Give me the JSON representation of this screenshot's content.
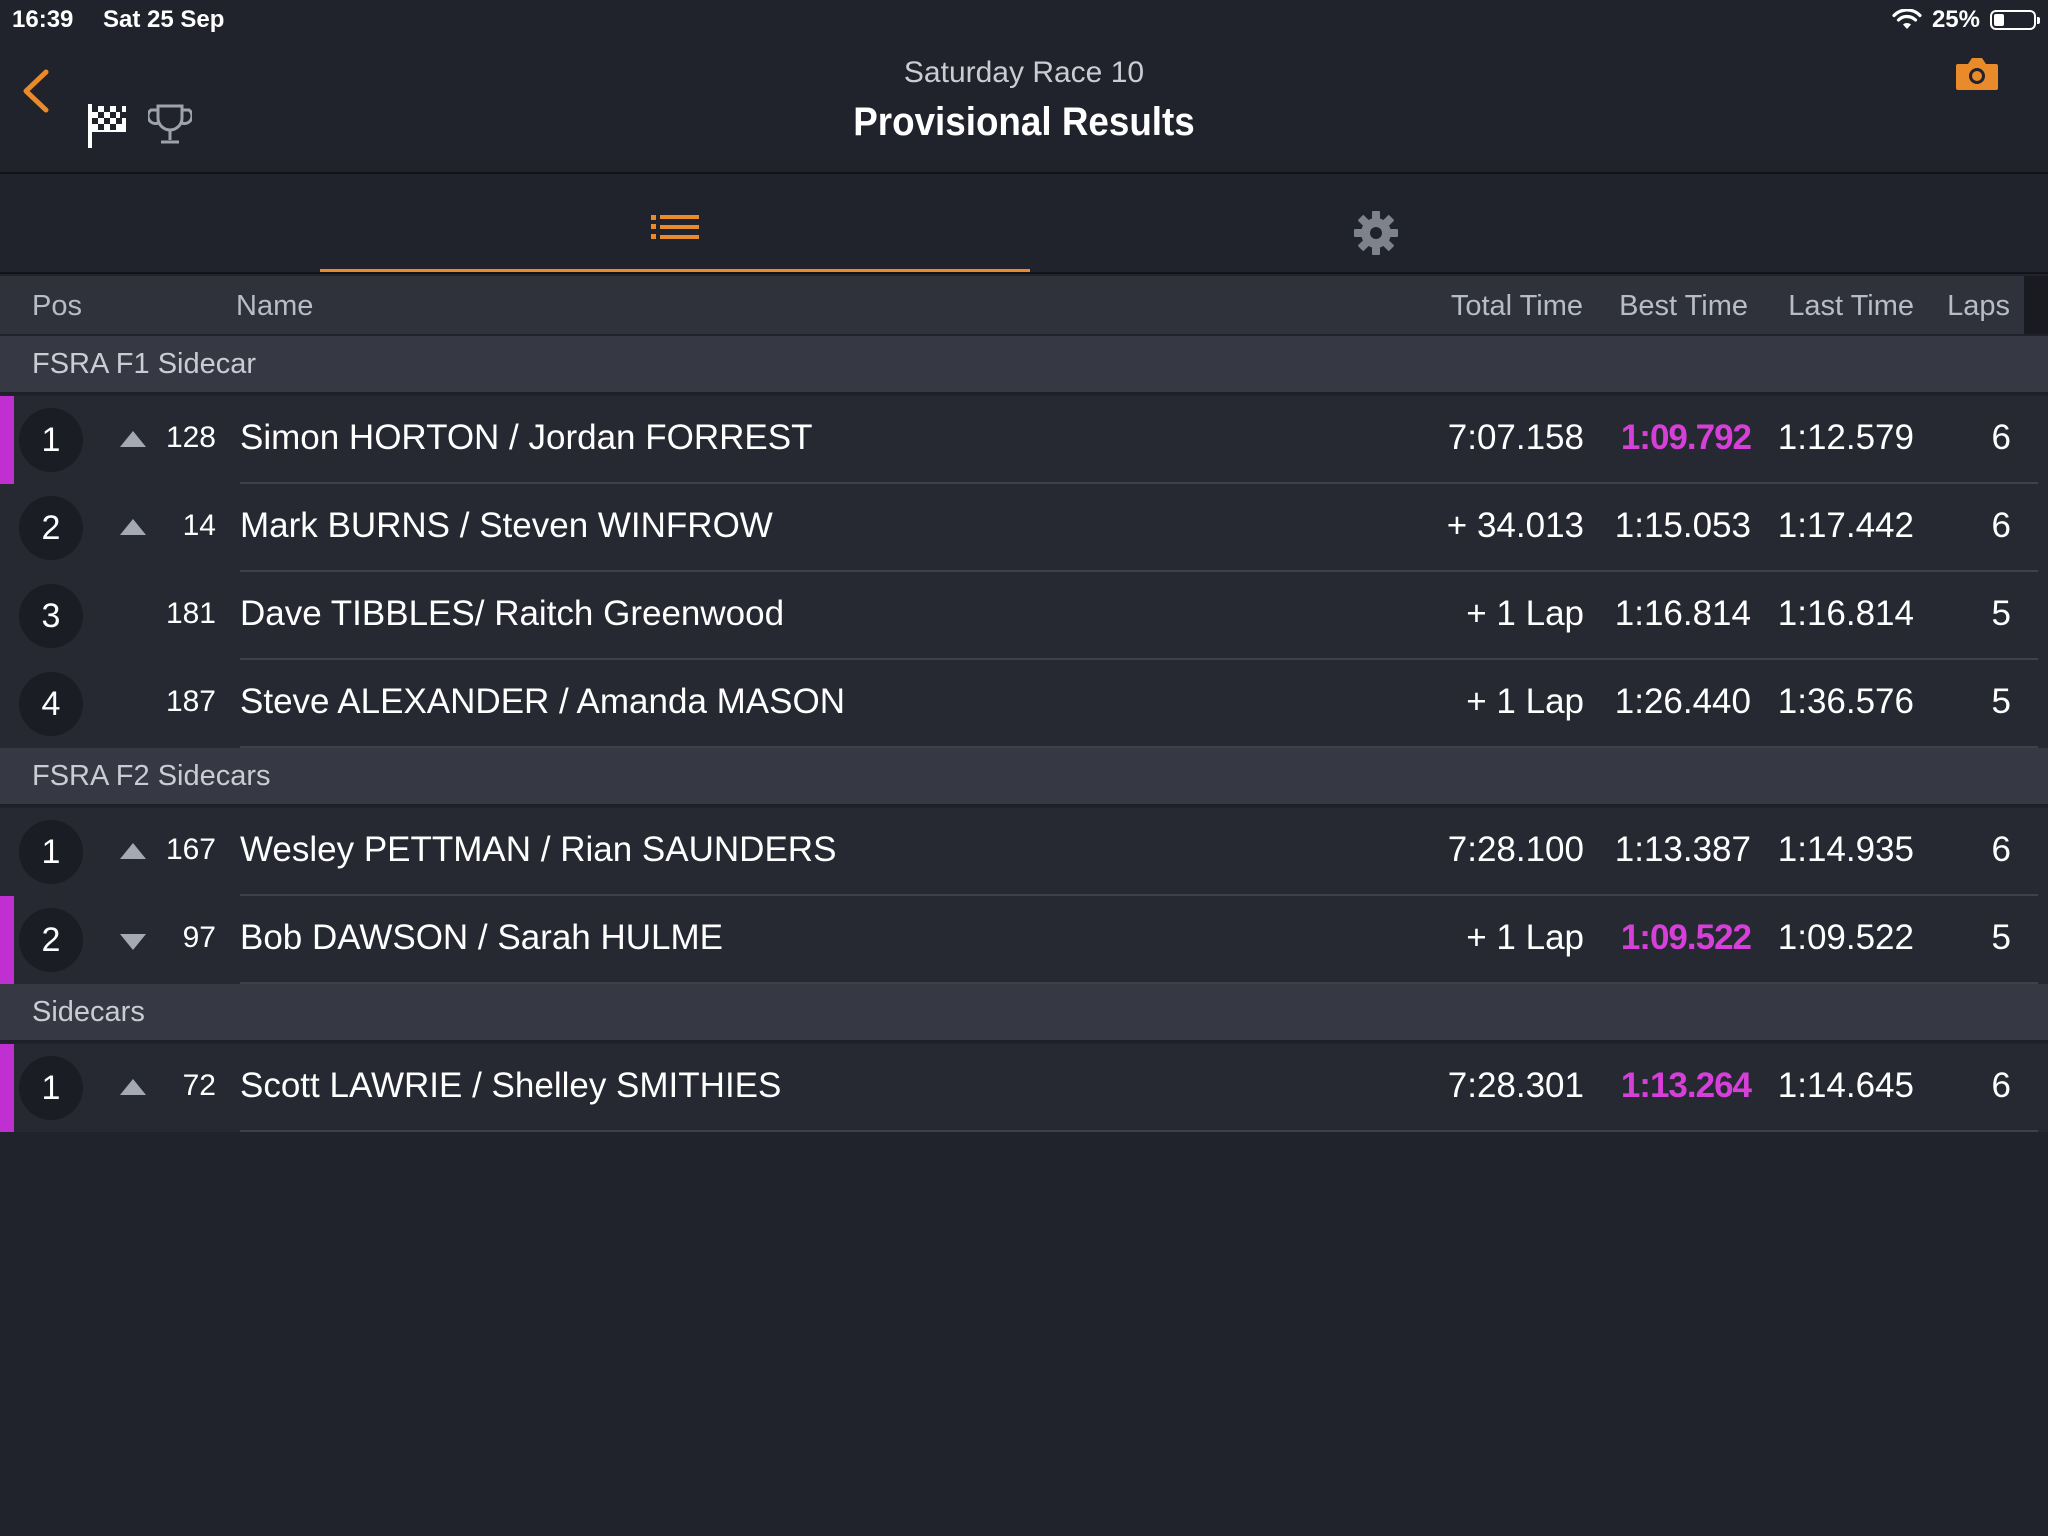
{
  "status_bar": {
    "time": "16:39",
    "date": "Sat 25 Sep",
    "battery": "25%",
    "battery_level": 0.25
  },
  "header": {
    "subtitle": "Saturday Race  10",
    "title": "Provisional Results"
  },
  "tabs": [
    {
      "name": "list",
      "icon": "list-icon",
      "active": true
    },
    {
      "name": "settings",
      "icon": "gear-icon",
      "active": false
    }
  ],
  "columns": {
    "pos": "Pos",
    "name": "Name",
    "total": "Total Time",
    "best": "Best Time",
    "last": "Last Time",
    "laps": "Laps"
  },
  "colors": {
    "accent": "#e98b2a",
    "fastest": "#d73fd9",
    "background": "#20232c"
  },
  "sections": [
    {
      "title": "FSRA F1 Sidecar",
      "rows": [
        {
          "pos": "1",
          "trend": "up",
          "num": "128",
          "name": "Simon HORTON / Jordan FORREST",
          "total": "7:07.158",
          "best": "1:09.792",
          "best_fastest": true,
          "last": "1:12.579",
          "laps": "6",
          "marker": true
        },
        {
          "pos": "2",
          "trend": "up",
          "num": "14",
          "name": "Mark BURNS / Steven WINFROW",
          "total": "+ 34.013",
          "best": "1:15.053",
          "best_fastest": false,
          "last": "1:17.442",
          "laps": "6",
          "marker": false
        },
        {
          "pos": "3",
          "trend": "",
          "num": "181",
          "name": "Dave TIBBLES/ Raitch Greenwood",
          "total": "+ 1 Lap",
          "best": "1:16.814",
          "best_fastest": false,
          "last": "1:16.814",
          "laps": "5",
          "marker": false
        },
        {
          "pos": "4",
          "trend": "",
          "num": "187",
          "name": "Steve ALEXANDER / Amanda MASON",
          "total": "+ 1 Lap",
          "best": "1:26.440",
          "best_fastest": false,
          "last": "1:36.576",
          "laps": "5",
          "marker": false
        }
      ]
    },
    {
      "title": "FSRA F2 Sidecars",
      "rows": [
        {
          "pos": "1",
          "trend": "up",
          "num": "167",
          "name": "Wesley PETTMAN / Rian SAUNDERS",
          "total": "7:28.100",
          "best": "1:13.387",
          "best_fastest": false,
          "last": "1:14.935",
          "laps": "6",
          "marker": false
        },
        {
          "pos": "2",
          "trend": "down",
          "num": "97",
          "name": "Bob DAWSON / Sarah HULME",
          "total": "+ 1 Lap",
          "best": "1:09.522",
          "best_fastest": true,
          "last": "1:09.522",
          "laps": "5",
          "marker": true
        }
      ]
    },
    {
      "title": "Sidecars",
      "rows": [
        {
          "pos": "1",
          "trend": "up",
          "num": "72",
          "name": "Scott LAWRIE / Shelley SMITHIES",
          "total": "7:28.301",
          "best": "1:13.264",
          "best_fastest": true,
          "last": "1:14.645",
          "laps": "6",
          "marker": true
        }
      ]
    }
  ]
}
